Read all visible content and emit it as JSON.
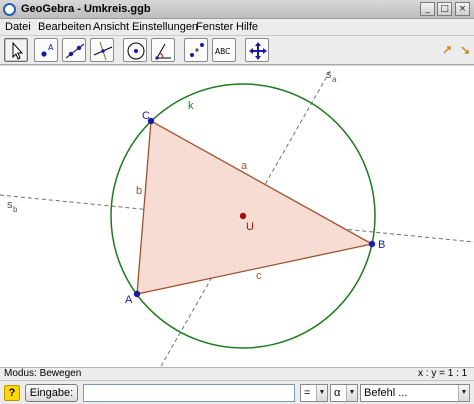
{
  "window": {
    "title": "GeoGebra - Umkreis.ggb",
    "minimize_glyph": "_",
    "maximize_glyph": "□",
    "close_glyph": "×"
  },
  "menu": [
    "Datei",
    "Bearbeiten",
    "Ansicht",
    "Einstellungen",
    "Fenster",
    "Hilfe"
  ],
  "toolbar": {
    "tools": [
      {
        "name": "move-tool",
        "icon": "cursor-arrow-icon",
        "selected": true
      },
      {
        "name": "point-tool",
        "icon": "point-A-icon",
        "label": "A"
      },
      {
        "name": "line-tool",
        "icon": "line-through-points-icon"
      },
      {
        "name": "perpendicular-tool",
        "icon": "perpendicular-line-icon"
      },
      {
        "name": "circle-tool",
        "icon": "circle-center-point-icon"
      },
      {
        "name": "angle-tool",
        "icon": "angle-icon"
      },
      {
        "name": "reflect-tool",
        "icon": "reflect-point-icon"
      },
      {
        "name": "text-tool",
        "icon": "text-abc-icon",
        "label": "ABC"
      },
      {
        "name": "move-view-tool",
        "icon": "move-graphics-view-icon"
      }
    ]
  },
  "canvas": {
    "points": {
      "A": "A",
      "B": "B",
      "C": "C",
      "U": "U"
    },
    "sides": {
      "a": "a",
      "b": "b",
      "c": "c"
    },
    "circle_label": "k",
    "bisector_labels": {
      "sa": "s",
      "sa_sub": "a",
      "sb": "s",
      "sb_sub": "b"
    },
    "colors": {
      "triangle_fill": "#f6dcd2",
      "triangle_stroke": "#a0522d",
      "circle": "#1e7a1e",
      "point": "#1a1aa6",
      "center_point": "#a01010",
      "bisector": "#707070",
      "label_brown": "#a0522d",
      "label_green": "#1e7a1e",
      "label_blue": "#1a1aa6"
    }
  },
  "status": {
    "mode": "Modus: Bewegen",
    "ratio": "x : y = 1 : 1"
  },
  "input_bar": {
    "help": "?",
    "button_label": "Eingabe:",
    "input_value": "",
    "operator": "=",
    "greek": "α",
    "command_placeholder": "Befehl ..."
  }
}
